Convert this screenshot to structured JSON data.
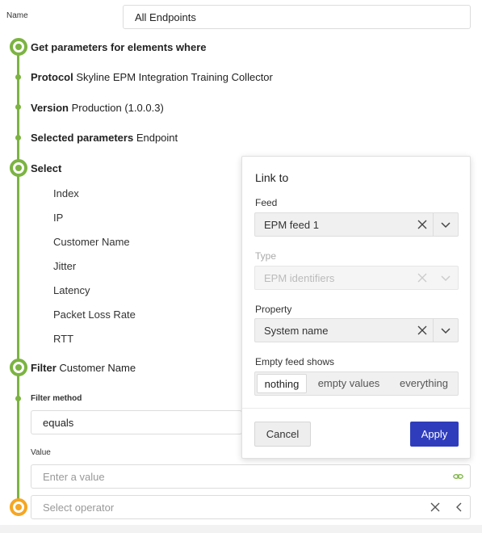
{
  "name_field": {
    "label": "Name",
    "value": "All Endpoints"
  },
  "steps": {
    "get_parameters": "Get parameters for elements where",
    "protocol": {
      "key": "Protocol",
      "value": "Skyline EPM Integration Training Collector"
    },
    "version": {
      "key": "Version",
      "value": "Production (1.0.0.3)"
    },
    "selected_parameters": {
      "key": "Selected parameters",
      "value": "Endpoint"
    },
    "select": "Select",
    "select_items": [
      "Index",
      "IP",
      "Customer Name",
      "Jitter",
      "Latency",
      "Packet Loss Rate",
      "RTT"
    ],
    "filter": {
      "key": "Filter",
      "value": "Customer Name"
    },
    "filter_method_label": "Filter method",
    "filter_method_value": "equals",
    "value_label": "Value",
    "value_placeholder": "Enter a value",
    "operator_placeholder": "Select operator"
  },
  "popup": {
    "title": "Link to",
    "feed_label": "Feed",
    "feed_value": "EPM feed 1",
    "type_label": "Type",
    "type_value": "EPM identifiers",
    "property_label": "Property",
    "property_value": "System name",
    "empty_label": "Empty feed shows",
    "empty_options": [
      "nothing",
      "empty values",
      "everything"
    ],
    "empty_selected": "nothing",
    "cancel_label": "Cancel",
    "apply_label": "Apply"
  },
  "colors": {
    "timeline": "#7cb342",
    "pending": "#f5a623",
    "apply": "#2f3dbd"
  },
  "icons": [
    "close-icon",
    "chevron-down-icon",
    "link-icon",
    "chevron-left-icon"
  ]
}
